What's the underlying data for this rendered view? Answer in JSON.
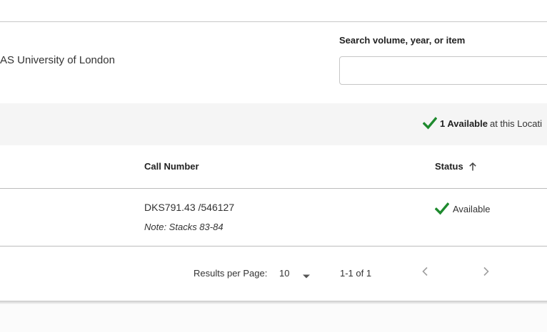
{
  "location": {
    "name": "AS University of London"
  },
  "search": {
    "label": "Search volume, year, or item",
    "value": "",
    "placeholder": ""
  },
  "availability": {
    "count_label": "1 Available",
    "suffix": "at this Locati",
    "icon": "check-icon"
  },
  "table": {
    "columns": {
      "call_number": "Call Number",
      "status": "Status"
    },
    "sort": {
      "column": "status",
      "direction": "ascending",
      "icon": "arrow-up-icon"
    },
    "rows": [
      {
        "call_number": "DKS791.43 /546127",
        "note": "Note: Stacks 83-84",
        "status": "Available"
      }
    ]
  },
  "pagination": {
    "rpp_label": "Results per Page:",
    "rpp_value": "10",
    "range": "1-1 of 1",
    "prev_icon": "chevron-left-icon",
    "next_icon": "chevron-right-icon"
  },
  "colors": {
    "check": "#1e8a2e",
    "bar_bg": "#f5f5f5",
    "disabled": "#9e9e9e"
  }
}
